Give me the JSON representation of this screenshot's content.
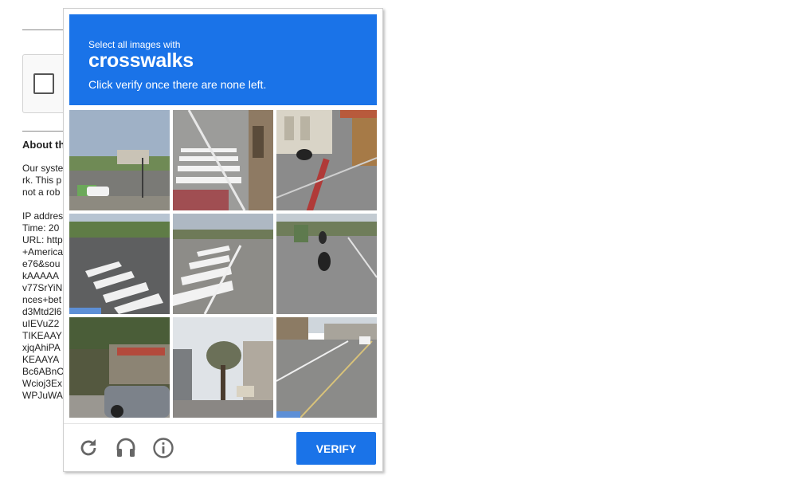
{
  "background": {
    "about_title": "About th",
    "about_body": "Our syste\nrk. This p\nnot a rob",
    "detail_lines": [
      "IP addres",
      "Time: 20",
      "URL: http",
      "+America",
      "e76&sou",
      "kAAAAA",
      "v77SrYiN",
      "nces+bet",
      "d3Mtd2l6",
      "uIEVuZ2",
      "TIKEAAY",
      "xjqAhiPA",
      "KEAAYA",
      "Bc6ABnO",
      "Wcioj3Ex",
      "WPJuWA"
    ]
  },
  "challenge": {
    "prompt_small": "Select all images with",
    "prompt_target": "crosswalks",
    "prompt_sub": "Click verify once there are none left.",
    "verify_label": "VERIFY",
    "tiles": [
      "tile-street-parking-lot",
      "tile-crosswalk-sidewalk",
      "tile-motorcyclist-street",
      "tile-crosswalk-intersection",
      "tile-crosswalk-highway",
      "tile-motorcycles-road",
      "tile-parked-car-building",
      "tile-street-trees",
      "tile-city-road"
    ],
    "icons": [
      "reload-icon",
      "headphones-icon",
      "info-icon"
    ],
    "colors": {
      "accent": "#1a73e8",
      "icon_gray": "#666666"
    }
  }
}
